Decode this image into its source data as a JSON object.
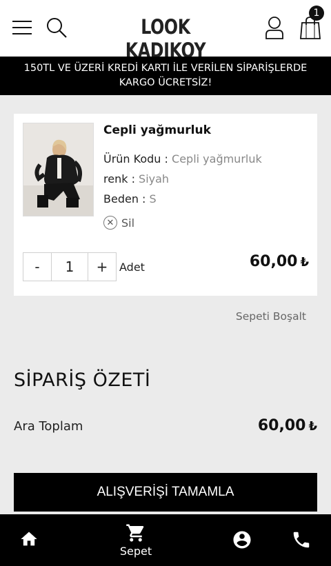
{
  "header": {
    "logo": "LOOK KADIKOY",
    "cart_count": "1"
  },
  "promo": {
    "line1": "150TL VE ÜZERİ KREDİ KARTI İLE VERİLEN SİPARİŞLERDE",
    "line2": "KARGO ÜCRETSİZ!"
  },
  "cart_item": {
    "title": "Cepli yağmurluk",
    "code_label": "Ürün Kodu :",
    "code_value": "Cepli yağmurluk",
    "color_label": "renk :",
    "color_value": "Siyah",
    "size_label": "Beden :",
    "size_value": "S",
    "remove_label": "Sil",
    "qty_minus": "-",
    "qty_value": "1",
    "qty_plus": "+",
    "qty_unit": "Adet",
    "price": "60,00",
    "currency": "₺"
  },
  "clear_cart": "Sepeti Boşalt",
  "summary": {
    "title": "SİPARİŞ ÖZETİ",
    "subtotal_label": "Ara Toplam",
    "subtotal_value": "60,00",
    "currency": "₺"
  },
  "checkout_label": "ALIŞVERİŞİ TAMAMLA",
  "bottom_nav": {
    "items": [
      {
        "icon": "home-icon",
        "label": ""
      },
      {
        "icon": "cart-icon",
        "label": "Sepet"
      },
      {
        "icon": "account-icon",
        "label": ""
      },
      {
        "icon": "phone-icon",
        "label": ""
      }
    ]
  },
  "colors": {
    "accent": "#000000",
    "background": "#ebebeb",
    "muted_value": "#888888"
  }
}
